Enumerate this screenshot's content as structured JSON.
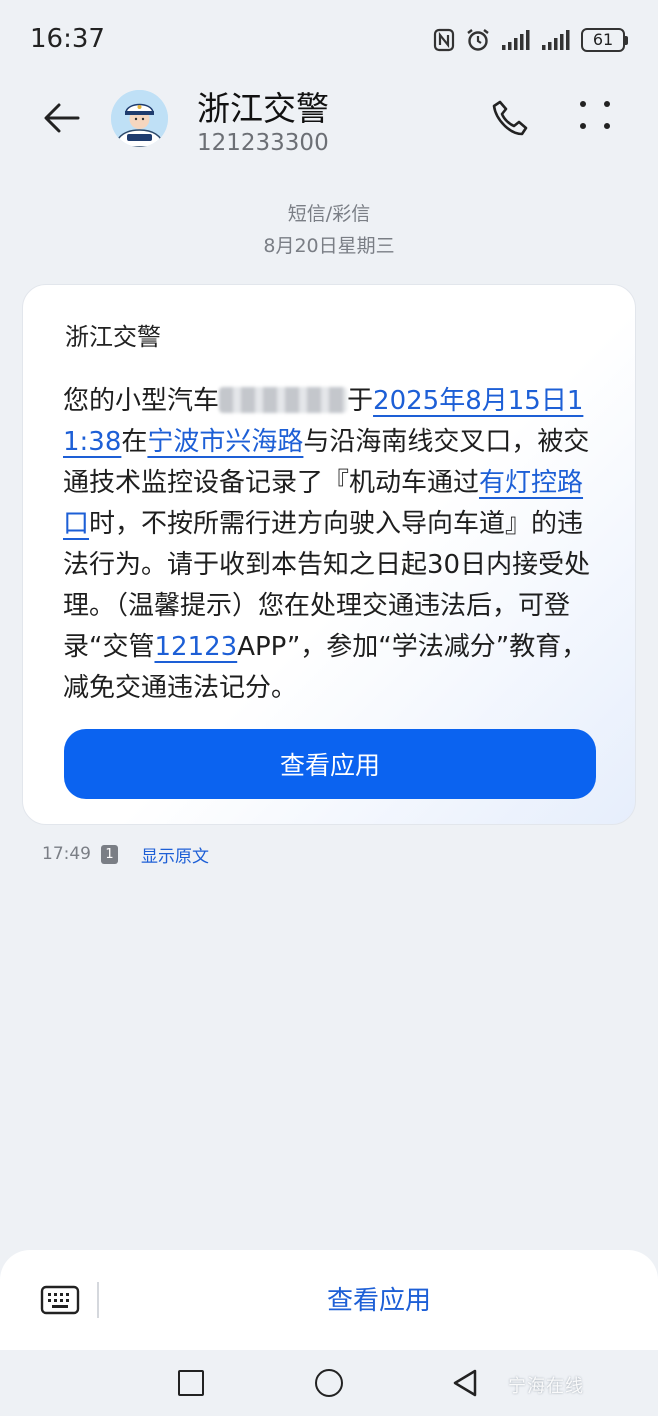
{
  "status_bar": {
    "time": "16:37",
    "battery": "61"
  },
  "header": {
    "contact_name": "浙江交警",
    "phone_number": "121233300"
  },
  "conversation_meta": {
    "type": "短信/彩信",
    "date": "8月20日星期三"
  },
  "message": {
    "sender_label": "浙江交警",
    "text_1": "您的小型汽车",
    "text_2": "于",
    "link_datetime": "2025年8月15日11:38",
    "text_3": "在",
    "link_location": "宁波市兴海路",
    "text_4": "与沿海南线交叉口，被交通技术监控设备记录了『机动车通过",
    "link_violation": "有灯控路口",
    "text_5": "时，不按所需行进方向驶入导向车道』的违法行为。请于收到本告知之日起30日内接受处理。（温馨提示）您在处理交通违法后，可登录“交管",
    "link_app": "12123",
    "text_6": "APP”，参加“学法减分”教育，减免交通违法记分。",
    "button_label": "查看应用",
    "time": "17:49",
    "sim": "1",
    "show_original": "显示原文"
  },
  "bottom_bar": {
    "action_label": "查看应用"
  },
  "watermark": "宁海在线",
  "colors": {
    "accent": "#0b63f0",
    "link": "#1d5fd6",
    "background": "#eef1f5"
  }
}
